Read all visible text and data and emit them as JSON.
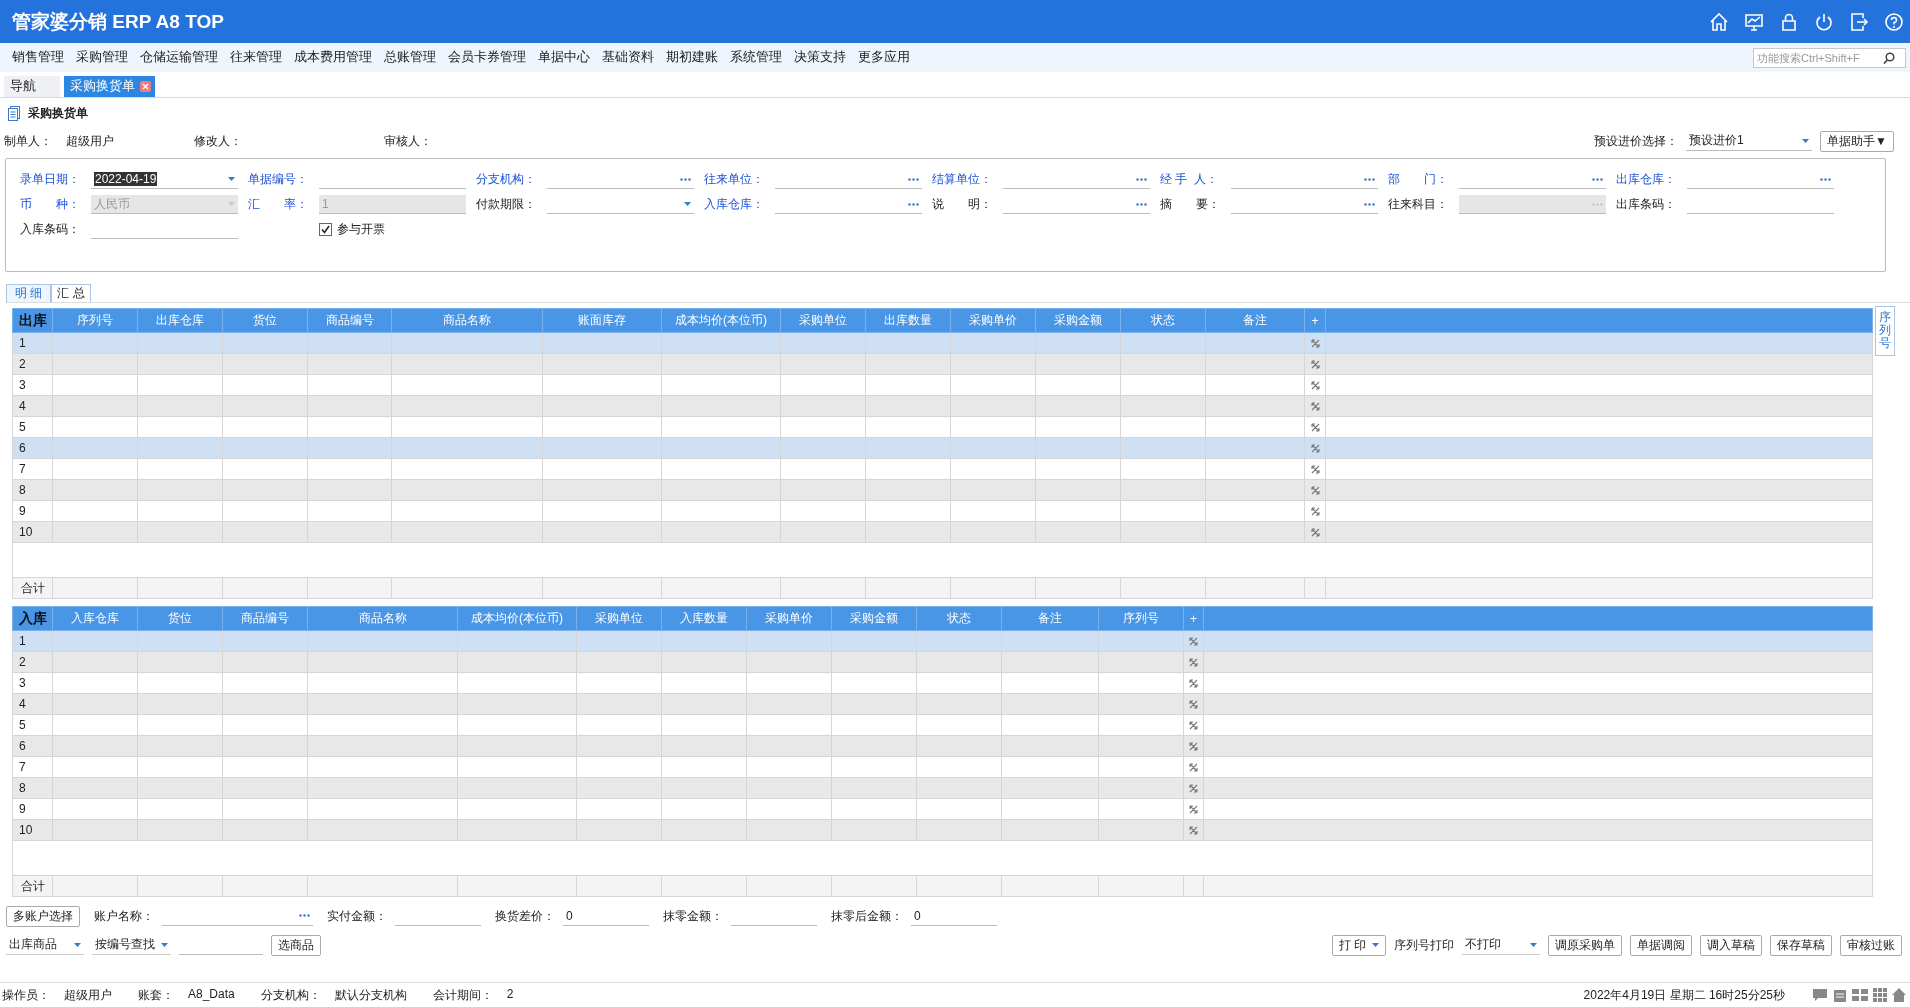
{
  "app": {
    "title": "管家婆分销 ERP A8 TOP"
  },
  "menu": [
    "销售管理",
    "采购管理",
    "仓储运输管理",
    "往来管理",
    "成本费用管理",
    "总账管理",
    "会员卡券管理",
    "单据中心",
    "基础资料",
    "期初建账",
    "系统管理",
    "决策支持",
    "更多应用"
  ],
  "search": {
    "placeholder": "功能搜索Ctrl+Shift+F"
  },
  "tabs": [
    {
      "label": "导航",
      "selected": false,
      "closable": false
    },
    {
      "label": "采购换货单",
      "selected": true,
      "closable": true
    }
  ],
  "document_title": "采购换货单",
  "people": [
    {
      "label": "制单人：",
      "value": "超级用户"
    },
    {
      "label": "修改人："
    },
    {
      "label": "审核人："
    }
  ],
  "price_preset": {
    "label": "预设进价选择：",
    "value": "预设进价1"
  },
  "helper_button": "单据助手▼",
  "form_rows": [
    [
      {
        "label": "录单日期：",
        "emphasis": true,
        "kind": "dropdown",
        "value": "2022-04-19",
        "value_selected": true,
        "disabled": false
      },
      {
        "label": "单据编号：",
        "emphasis": true,
        "kind": "text",
        "disabled": false
      },
      {
        "label": "分支机构：",
        "emphasis": true,
        "kind": "picker",
        "disabled": false
      },
      {
        "label": "往来单位：",
        "emphasis": true,
        "kind": "picker",
        "disabled": false
      },
      {
        "label": "结算单位：",
        "emphasis": true,
        "kind": "picker",
        "disabled": false
      },
      {
        "label": "经 手  人：",
        "emphasis": true,
        "kind": "picker",
        "disabled": false
      },
      {
        "label": "部　　门：",
        "emphasis": true,
        "kind": "picker",
        "disabled": false
      },
      {
        "label": "出库仓库：",
        "emphasis": true,
        "kind": "picker",
        "disabled": false
      }
    ],
    [
      {
        "label": "币　　种：",
        "emphasis": true,
        "kind": "dropdown",
        "value": "人民币",
        "disabled": true
      },
      {
        "label": "汇　　率：",
        "emphasis": true,
        "kind": "text",
        "value": "1",
        "disabled": true
      },
      {
        "label": "付款期限：",
        "emphasis": false,
        "kind": "dropdown",
        "disabled": false
      },
      {
        "label": "入库仓库：",
        "emphasis": true,
        "kind": "picker",
        "disabled": false
      },
      {
        "label": "说　　明：",
        "emphasis": false,
        "kind": "picker",
        "disabled": false
      },
      {
        "label": "摘　　要：",
        "emphasis": false,
        "kind": "picker",
        "disabled": false
      },
      {
        "label": "往来科目：",
        "emphasis": false,
        "kind": "picker",
        "disabled": true
      },
      {
        "label": "出库条码：",
        "emphasis": false,
        "kind": "text",
        "disabled": false
      }
    ],
    [
      {
        "label": "入库条码：",
        "emphasis": false,
        "kind": "text",
        "disabled": false
      },
      {
        "label": "参与开票",
        "kind": "checkbox",
        "checked": true
      }
    ]
  ],
  "detail_tabs": [
    {
      "label": "明 细",
      "selected": true
    },
    {
      "label": "汇 总",
      "selected": false
    }
  ],
  "tables": [
    {
      "corner": "出库",
      "add_symbol": "+",
      "total_label": "合计",
      "columns": [
        "序列号",
        "出库仓库",
        "货位",
        "商品编号",
        "商品名称",
        "账面库存",
        "成本均价(本位币)",
        "采购单位",
        "出库数量",
        "采购单价",
        "采购金额",
        "状态",
        "备注"
      ],
      "rows": [
        {
          "number": "1",
          "selected": true
        },
        {
          "number": "2",
          "selected": false
        },
        {
          "number": "3",
          "selected": false
        },
        {
          "number": "4",
          "selected": false
        },
        {
          "number": "5",
          "selected": false
        },
        {
          "number": "6",
          "selected": true
        },
        {
          "number": "7",
          "selected": false
        },
        {
          "number": "8",
          "selected": false
        },
        {
          "number": "9",
          "selected": false
        },
        {
          "number": "10",
          "selected": false
        }
      ]
    },
    {
      "corner": "入库",
      "add_symbol": "+",
      "total_label": "合计",
      "columns": [
        "入库仓库",
        "货位",
        "商品编号",
        "商品名称",
        "成本均价(本位币)",
        "采购单位",
        "入库数量",
        "采购单价",
        "采购金额",
        "状态",
        "备注",
        "序列号"
      ],
      "rows": [
        {
          "number": "1",
          "selected": true
        },
        {
          "number": "2",
          "selected": false
        },
        {
          "number": "3",
          "selected": false
        },
        {
          "number": "4",
          "selected": false
        },
        {
          "number": "5",
          "selected": false
        },
        {
          "number": "6",
          "selected": false
        },
        {
          "number": "7",
          "selected": false
        },
        {
          "number": "8",
          "selected": false
        },
        {
          "number": "9",
          "selected": false
        },
        {
          "number": "10",
          "selected": false
        }
      ]
    }
  ],
  "side_tab": "序列号",
  "payment_row": [
    {
      "kind": "button",
      "label": "多账户选择"
    },
    {
      "kind": "picker",
      "label": "账户名称："
    },
    {
      "kind": "text",
      "label": "实付金额："
    },
    {
      "kind": "text",
      "label": "换货差价：",
      "value": "0"
    },
    {
      "kind": "text",
      "label": "抹零金额："
    },
    {
      "kind": "text",
      "label": "抹零后金额：",
      "value": "0"
    }
  ],
  "action_left": [
    {
      "kind": "select",
      "value": "出库商品"
    },
    {
      "kind": "select",
      "value": "按编号查找"
    },
    {
      "kind": "text"
    },
    {
      "kind": "button",
      "label": "选商品"
    }
  ],
  "action_right": [
    {
      "kind": "menu_button",
      "label": "打 印"
    },
    {
      "kind": "label",
      "label": "序列号打印"
    },
    {
      "kind": "select",
      "value": "不打印"
    },
    {
      "kind": "button",
      "label": "调原采购单"
    },
    {
      "kind": "button",
      "label": "单据调阅"
    },
    {
      "kind": "button",
      "label": "调入草稿"
    },
    {
      "kind": "button",
      "label": "保存草稿"
    },
    {
      "kind": "button",
      "label": "审核过账"
    }
  ],
  "status_bar": {
    "items": [
      {
        "label": "操作员：",
        "value": "超级用户"
      },
      {
        "label": "账套：",
        "value": "A8_Data"
      },
      {
        "label": "分支机构：",
        "value": "默认分支机构"
      },
      {
        "label": "会计期间：",
        "value": "2"
      }
    ],
    "datetime": "2022年4月19日  星期二  16时25分25秒"
  }
}
